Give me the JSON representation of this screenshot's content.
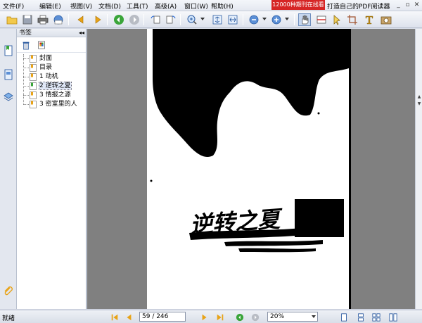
{
  "menubar": {
    "items": [
      "文件(F)",
      "编辑(E)",
      "视图(V)",
      "文档(D)",
      "工具(T)",
      "高级(A)",
      "窗口(W)",
      "帮助(H)"
    ],
    "ad_banner": "12000种期刊在线看",
    "ad_text": "打造自己的PDF阅读器"
  },
  "toolbar": {
    "icons": [
      "open-icon",
      "save-icon",
      "print-icon",
      "email-icon",
      "prev-page-icon",
      "next-page-icon",
      "back-icon",
      "forward-icon",
      "rotate-left-icon",
      "rotate-right-icon",
      "zoom-in-icon",
      "fit-page-icon",
      "fit-width-icon",
      "zoom-out-icon",
      "zoom-plus-icon",
      "hand-tool-icon",
      "reading-icon",
      "select-tool-icon",
      "text-tool-icon",
      "snapshot-icon"
    ]
  },
  "bookmarks": {
    "title": "书签",
    "items": [
      {
        "label": "封面",
        "selected": false
      },
      {
        "label": "目录",
        "selected": false
      },
      {
        "label": "1   动机",
        "selected": false
      },
      {
        "label": "2   逆转之夏",
        "selected": true
      },
      {
        "label": "3   情报之源",
        "selected": false
      },
      {
        "label": "3   密室里的人",
        "selected": false
      }
    ]
  },
  "page_content": {
    "handwritten_title": "逆转之夏"
  },
  "status": {
    "text": "就绪",
    "page_value": "59 / 246",
    "zoom_value": "20%"
  },
  "colors": {
    "accent_green": "#3aa53a",
    "accent_orange": "#e8a317",
    "ad_red": "#d62525"
  }
}
